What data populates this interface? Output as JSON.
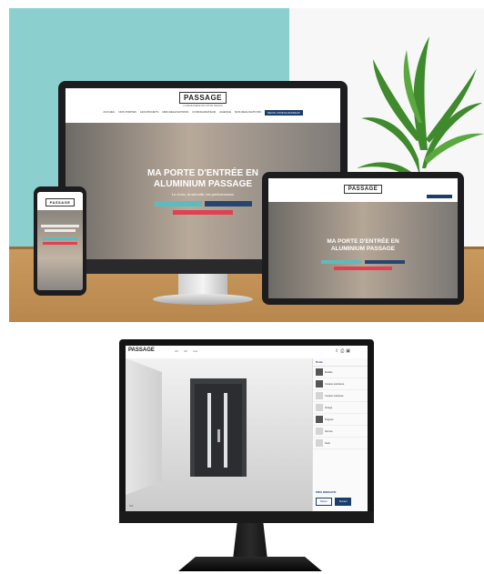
{
  "responsive_site": {
    "logo": "PASSAGE",
    "tagline": "LA MENUISERIE DE VOTRE MAISON",
    "nav": [
      "ACCUEIL",
      "NOS PORTES",
      "LES PROJETS",
      "MES REALISATIONS",
      "CONFIGURATEUR",
      "AGENCE",
      "NOS REALISATIONS",
      "CONTACT"
    ],
    "nav_cta": "DEVIS CONFIGURATEUR",
    "hero_title_line1": "MA PORTE D'ENTRÉE EN",
    "hero_title_line2": "ALUMINIUM PASSAGE",
    "hero_subtitle": "Le choix, la sécurité, les performances",
    "btn_primary": "JE CONFIGURE MA PORTE",
    "btn_secondary": "DEMANDER UN DEVIS",
    "btn_tertiary": "TROUVER MON MAGASIN"
  },
  "configurator": {
    "logo": "PASSAGE",
    "toolbar": [
      "2D",
      "3D",
      "Vue"
    ],
    "icons": [
      "share-icon",
      "print-icon",
      "save-icon"
    ],
    "sidebar_header": "Porte",
    "options": [
      {
        "label": "Modèle",
        "thumb": "dark"
      },
      {
        "label": "Couleur extérieure",
        "thumb": "dark"
      },
      {
        "label": "Couleur intérieure",
        "thumb": "light"
      },
      {
        "label": "Vitrage",
        "thumb": "light"
      },
      {
        "label": "Poignée",
        "thumb": "dark"
      },
      {
        "label": "Serrure",
        "thumb": "light"
      },
      {
        "label": "Seuil",
        "thumb": "light"
      }
    ],
    "total_label": "PRIX INDICATIF",
    "btn_back": "Retour",
    "btn_next": "Suivant",
    "floor_hint": "Sol"
  }
}
